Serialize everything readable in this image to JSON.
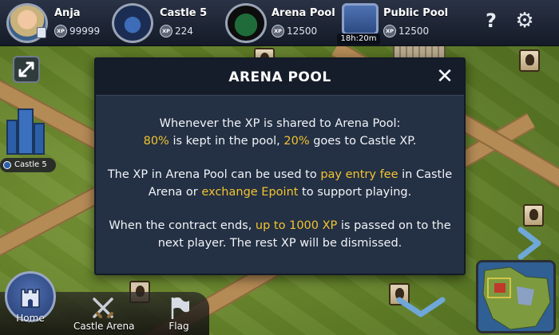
{
  "topbar": {
    "user": {
      "name": "Anja",
      "xp_badge": "XP",
      "xp": "99999"
    },
    "castle": {
      "name": "Castle 5",
      "xp_badge": "XP",
      "xp": "224"
    },
    "arena_pool": {
      "name": "Arena Pool",
      "xp_badge": "XP",
      "xp": "12500"
    },
    "public_pool": {
      "name": "Public Pool",
      "xp_badge": "XP",
      "xp": "12500",
      "timer": "18h:20m"
    },
    "help_label": "?"
  },
  "map": {
    "castle_label": "Castle 5"
  },
  "modal": {
    "title": "ARENA POOL",
    "close_label": "✕",
    "p1": {
      "a": "Whenever the XP is shared to Arena Pool:",
      "h1": "80%",
      "b": " is kept in the pool, ",
      "h2": "20%",
      "c": " goes to Castle XP."
    },
    "p2": {
      "a": "The XP in Arena Pool can be used to ",
      "h1": "pay entry fee",
      "b": " in Castle Arena or ",
      "h2": "exchange Epoint",
      "c": " to support playing."
    },
    "p3": {
      "a": "When the contract ends, ",
      "h1": "up to 1000 XP",
      "b": " is passed on to the next player. The rest XP will be dismissed."
    }
  },
  "bottombar": {
    "home_label": "Home",
    "arena_label": "Castle Arena",
    "flag_label": "Flag"
  },
  "colors": {
    "modal_bg": "#243043",
    "modal_header": "#161d2a",
    "highlight": "#f3c431",
    "topbar": "#1c2333"
  },
  "icons": [
    "avatar-icon",
    "castle-icon",
    "pool-icon",
    "safe-icon",
    "help-icon",
    "gear-icon",
    "expand-icon",
    "close-icon",
    "home-icon",
    "crossed-swords-icon",
    "flag-icon",
    "chevron-right-icon",
    "chevron-down-icon"
  ]
}
